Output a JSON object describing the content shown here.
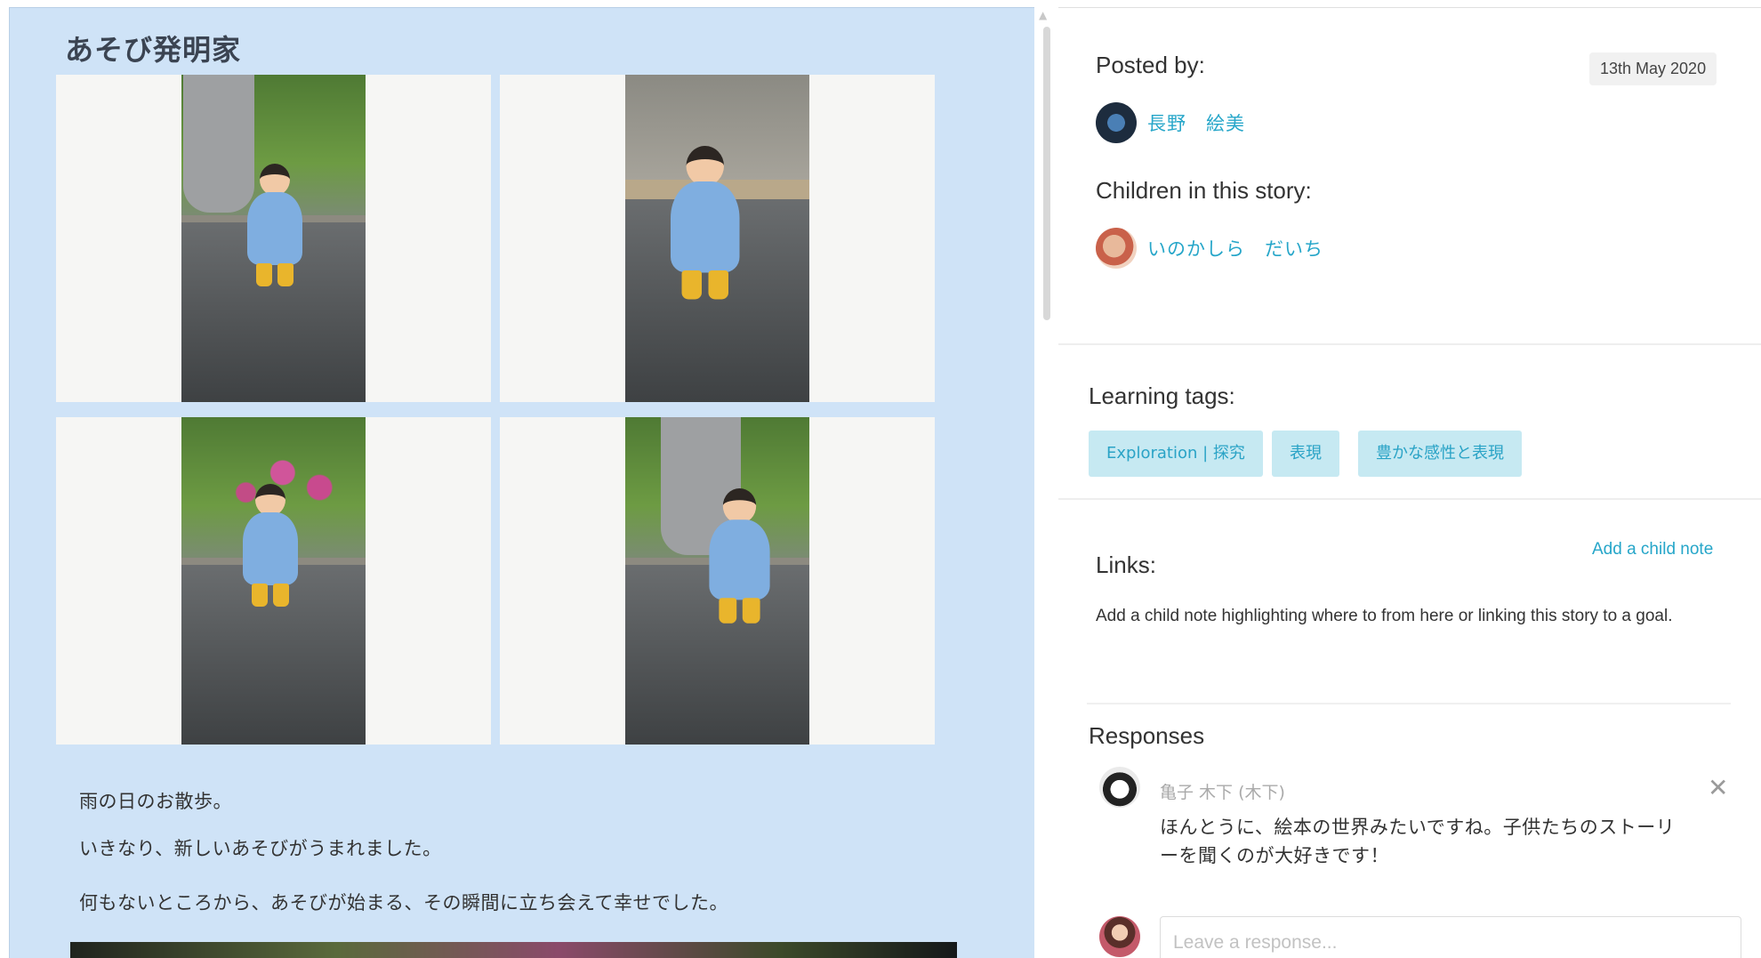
{
  "story": {
    "title": "あそび発明家",
    "paragraphs": [
      "雨の日のお散歩。",
      "いきなり、新しいあそびがうまれました。",
      "何もないところから、あそびが始まる、その瞬間に立ち会えて幸せでした。"
    ],
    "photos": [
      {
        "scene": "child-in-raincoat-near-plants"
      },
      {
        "scene": "child-smiling-on-wet-pavement"
      },
      {
        "scene": "child-near-flower-bushes"
      },
      {
        "scene": "child-walking-on-pavement"
      }
    ]
  },
  "info": {
    "posted_by_label": "Posted by:",
    "date": "13th May 2020",
    "poster_name": "長野　絵美",
    "children_label": "Children in this story:",
    "child_name": "いのかしら　だいち",
    "learning_tags_label": "Learning tags:",
    "tags": [
      "Exploration | 探究",
      "表現",
      "豊かな感性と表現"
    ],
    "links_label": "Links:",
    "add_child_note": "Add a child note",
    "links_description": "Add a child note highlighting where to from here or linking this story to a goal.",
    "responses_label": "Responses",
    "response": {
      "author": "亀子 木下 (木下)",
      "text": "ほんとうに、絵本の世界みたいですね。子供たちのストーリーを聞くのが大好きです！"
    },
    "response_placeholder": "Leave a response..."
  },
  "colors": {
    "story_background": "#cfe3f7",
    "accent": "#26a6c9",
    "tag_background": "#c6e9f2"
  },
  "icons": {
    "close": "close-icon",
    "scroll_up": "scroll-up-arrow-icon"
  }
}
